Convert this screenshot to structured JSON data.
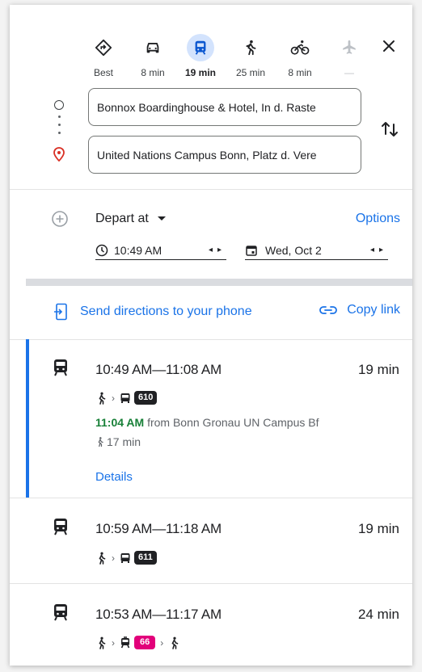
{
  "modes": [
    {
      "label": "Best",
      "icon": "diamond-directions-icon",
      "active": false
    },
    {
      "label": "8 min",
      "icon": "car-icon",
      "active": false
    },
    {
      "label": "19 min",
      "icon": "transit-icon",
      "active": true
    },
    {
      "label": "25 min",
      "icon": "walk-icon",
      "active": false
    },
    {
      "label": "8 min",
      "icon": "bicycle-icon",
      "active": false
    },
    {
      "label": "—",
      "icon": "flight-icon",
      "active": false
    }
  ],
  "origin": {
    "value": "Bonnox Boardinghouse & Hotel, In d. Raste"
  },
  "destination": {
    "value": "United Nations Campus Bonn, Platz d. Vere"
  },
  "depart": {
    "label": "Depart at",
    "options_label": "Options",
    "time": "10:49 AM",
    "date": "Wed, Oct 2"
  },
  "share": {
    "send_label": "Send directions to your phone",
    "copy_label": "Copy link"
  },
  "routes": [
    {
      "times": "10:49 AM—11:08 AM",
      "duration": "19 min",
      "line": "610",
      "line_color": "#202124",
      "departure_time": "11:04 AM",
      "departure_from": "from Bonn Gronau UN Campus Bf",
      "walk": "17 min",
      "details_label": "Details"
    },
    {
      "times": "10:59 AM—11:18 AM",
      "duration": "19 min",
      "line": "611",
      "line_color": "#202124"
    },
    {
      "times": "10:53 AM—11:17 AM",
      "duration": "24 min",
      "line": "66",
      "line_color": "#e2007a"
    }
  ],
  "colors": {
    "accent": "#1a73e8",
    "selected_bar": "#1a73e8",
    "green_time": "#188038",
    "origin_pin": "#d93025"
  }
}
